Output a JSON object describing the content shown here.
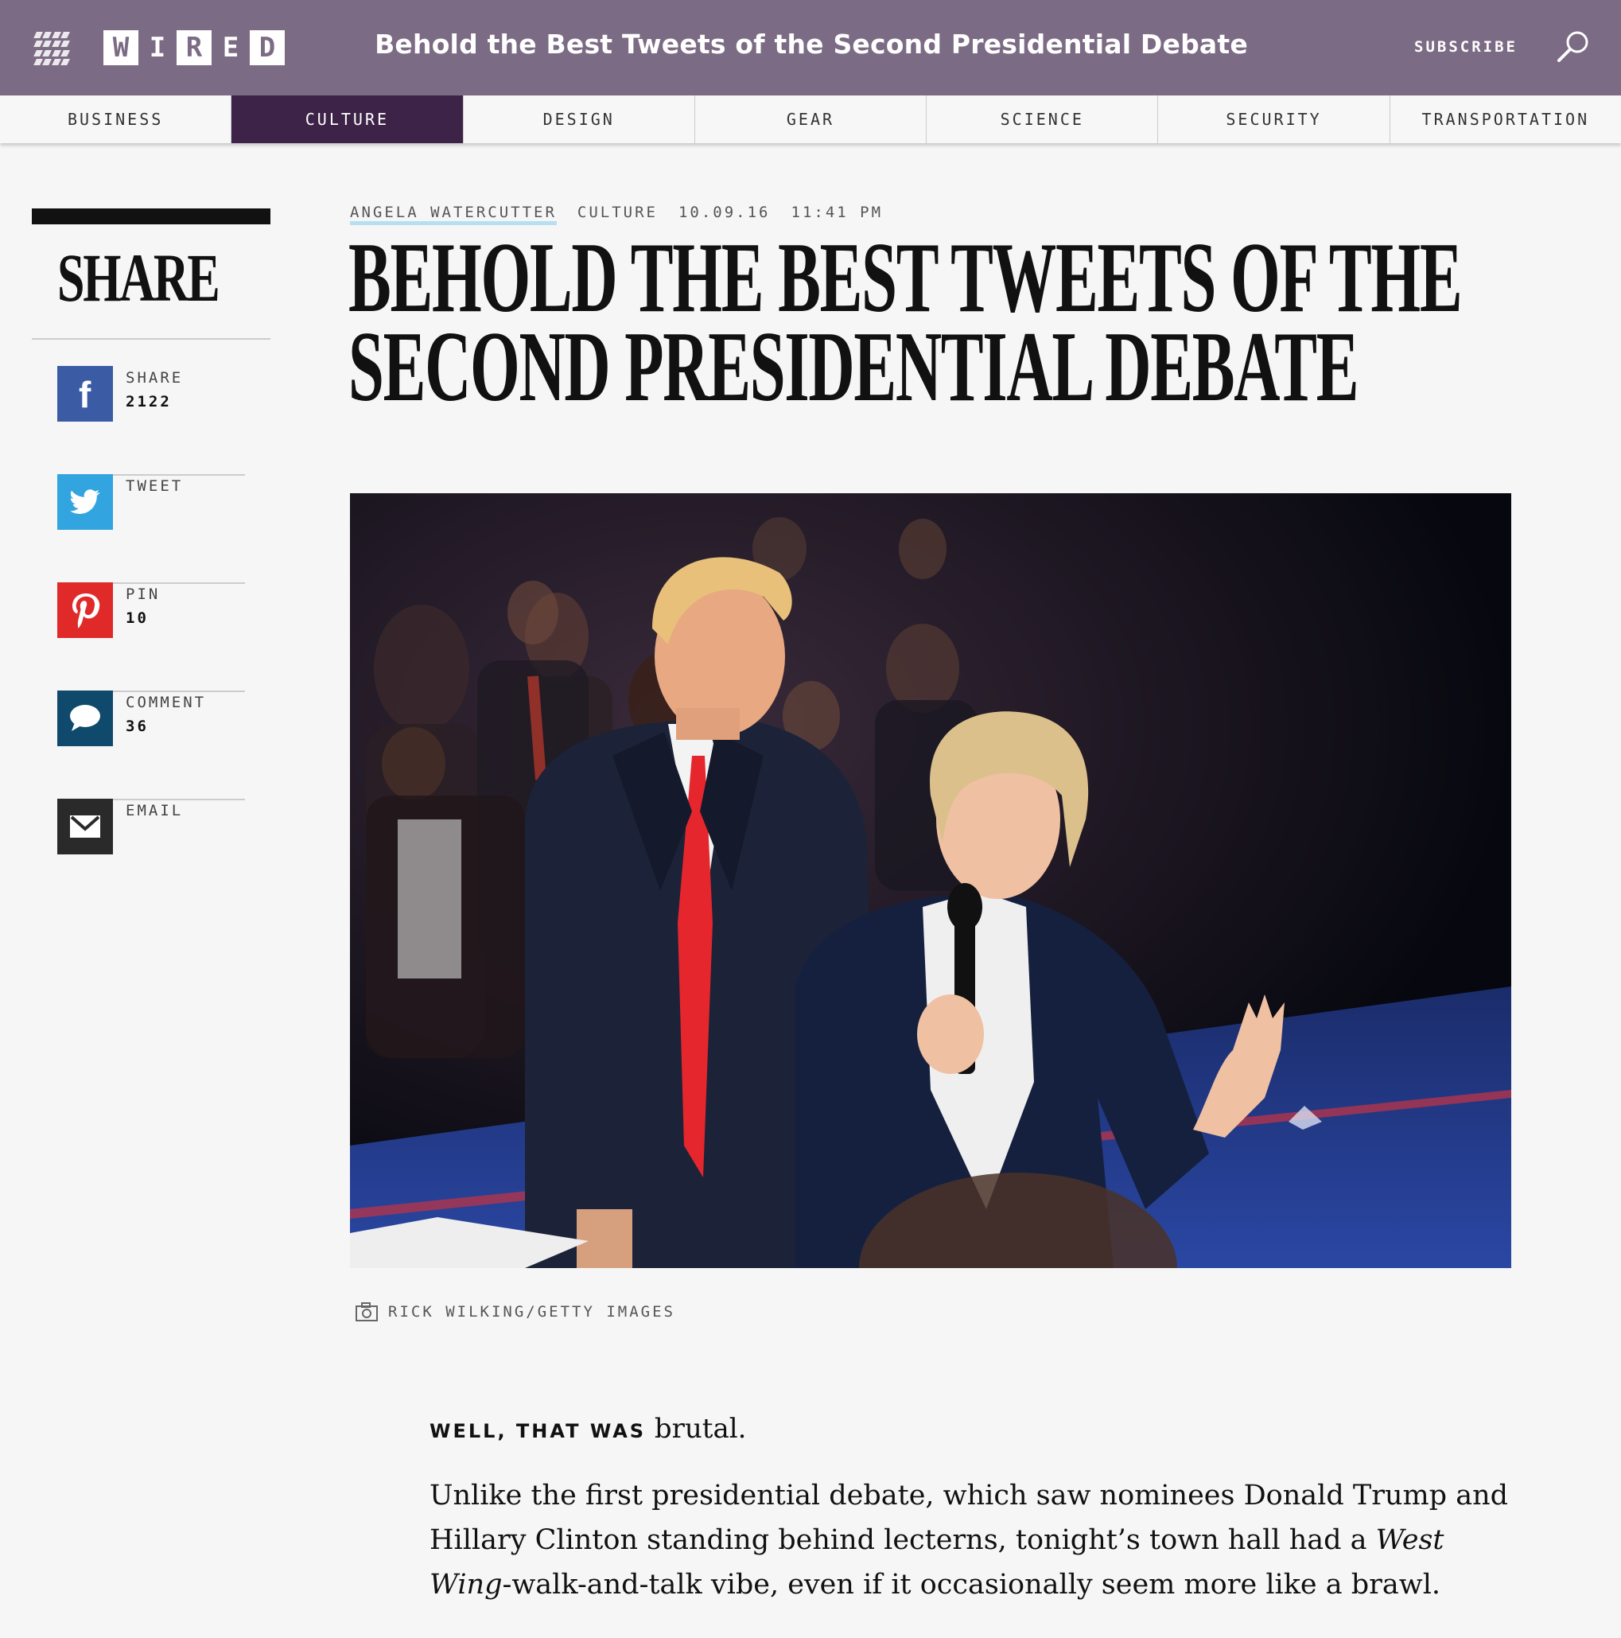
{
  "header": {
    "logo": [
      "W",
      "I",
      "R",
      "E",
      "D"
    ],
    "title": "Behold the Best Tweets of the Second Presidential Debate",
    "subscribe_label": "SUBSCRIBE",
    "colors": {
      "bar": "#7c6b84",
      "active_tab": "#3d2347"
    }
  },
  "nav": {
    "items": [
      "BUSINESS",
      "CULTURE",
      "DESIGN",
      "GEAR",
      "SCIENCE",
      "SECURITY",
      "TRANSPORTATION"
    ],
    "active": "CULTURE"
  },
  "share": {
    "title": "SHARE",
    "items": [
      {
        "label": "SHARE",
        "count": "2122",
        "icon": "facebook-icon",
        "color": "#3b5ba5"
      },
      {
        "label": "TWEET",
        "count": "",
        "icon": "twitter-icon",
        "color": "#32a4e0"
      },
      {
        "label": "PIN",
        "count": "10",
        "icon": "pinterest-icon",
        "color": "#e02a2a"
      },
      {
        "label": "COMMENT",
        "count": "36",
        "icon": "comment-icon",
        "color": "#0f4a6c"
      },
      {
        "label": "EMAIL",
        "count": "",
        "icon": "email-icon",
        "color": "#2a2a2a"
      }
    ]
  },
  "article": {
    "author": "ANGELA WATERCUTTER",
    "section": "CULTURE",
    "date": "10.09.16",
    "time": "11:41 PM",
    "headline_line1": "BEHOLD THE BEST TWEETS OF THE",
    "headline_line2": "SECOND PRESIDENTIAL DEBATE",
    "photo_credit": "RICK WILKING/GETTY IMAGES",
    "lead_caps": "WELL, THAT WAS",
    "lead_rest": "brutal.",
    "para_part1": "Unlike the first presidential debate, which saw nominees Donald Trump and Hillary Clinton standing behind lecterns, tonight’s town hall had a ",
    "para_italic": "West Wing",
    "para_part2": "-walk-and-talk vibe, even if it occasionally seem more like a brawl."
  }
}
